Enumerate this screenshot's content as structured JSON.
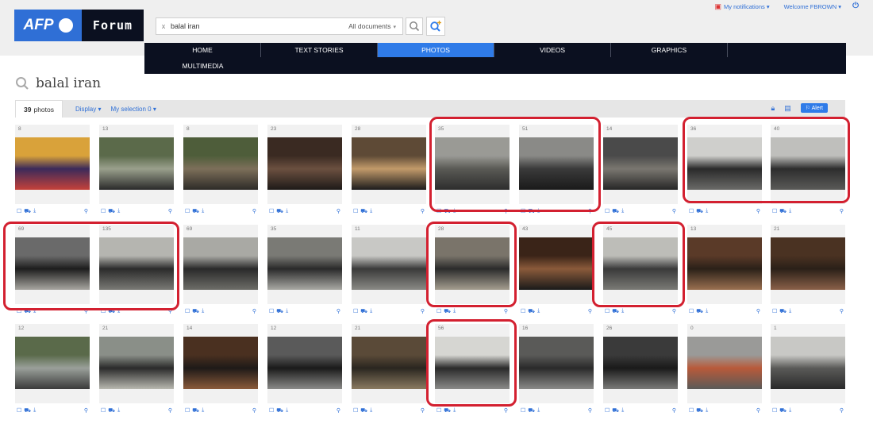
{
  "logo": {
    "afp": "AFP",
    "forum": "Forum"
  },
  "search": {
    "clear": "x",
    "query": "balal iran",
    "scope": "All documents"
  },
  "user": {
    "notifications": "My notifications",
    "welcome": "Welcome FBROWN"
  },
  "nav": {
    "items": [
      "HOME",
      "TEXT STORIES",
      "PHOTOS",
      "VIDEOS",
      "GRAPHICS",
      "MULTIMEDIA"
    ],
    "active": "PHOTOS"
  },
  "results": {
    "title": "balal iran",
    "count": "39",
    "count_label": "photos",
    "display": "Display",
    "selection": "My selection 0",
    "alert": "Alert"
  },
  "photos": [
    {
      "count": "8",
      "colors": [
        "#d9a23a",
        "#3b2a5a",
        "#c4413a"
      ]
    },
    {
      "count": "13",
      "colors": [
        "#5b6a4a",
        "#9aa08c",
        "#2a2a2a"
      ]
    },
    {
      "count": "8",
      "colors": [
        "#4e5d3a",
        "#7d6f5a",
        "#2d2b27"
      ]
    },
    {
      "count": "23",
      "colors": [
        "#3a2a22",
        "#6b5040",
        "#1e1a18"
      ]
    },
    {
      "count": "28",
      "colors": [
        "#5e4a36",
        "#c29a6a",
        "#1c1c1c"
      ]
    },
    {
      "count": "35",
      "colors": [
        "#9a9a95",
        "#5a5a55",
        "#2d2d2d"
      ]
    },
    {
      "count": "51",
      "colors": [
        "#8a8a87",
        "#3a3a3a",
        "#1a1a1a"
      ]
    },
    {
      "count": "14",
      "colors": [
        "#4a4a4a",
        "#7a7770",
        "#262626"
      ]
    },
    {
      "count": "36",
      "colors": [
        "#cfcfcc",
        "#2a2a2a",
        "#6a6a68"
      ]
    },
    {
      "count": "40",
      "colors": [
        "#bfbfbc",
        "#2d2d2d",
        "#5a5a58"
      ]
    },
    {
      "count": "69",
      "colors": [
        "#6a6a6a",
        "#1d1d1d",
        "#a8a6a0"
      ]
    },
    {
      "count": "135",
      "colors": [
        "#b5b5b0",
        "#2b2b2b",
        "#7a7a75"
      ]
    },
    {
      "count": "69",
      "colors": [
        "#a9a9a4",
        "#2a2a2a",
        "#6d6d68"
      ]
    },
    {
      "count": "35",
      "colors": [
        "#7a7a75",
        "#2a2a2a",
        "#a9a9a4"
      ]
    },
    {
      "count": "11",
      "colors": [
        "#c8c8c5",
        "#3a3a3a",
        "#8a8a85"
      ]
    },
    {
      "count": "28",
      "colors": [
        "#7a746a",
        "#2b2b2b",
        "#a59e90"
      ]
    },
    {
      "count": "43",
      "colors": [
        "#3a2418",
        "#8a5a3a",
        "#1a1a1a"
      ]
    },
    {
      "count": "45",
      "colors": [
        "#bdbdb8",
        "#3a3a3a",
        "#7a7a75"
      ]
    },
    {
      "count": "13",
      "colors": [
        "#5a3a28",
        "#2a2018",
        "#9a7050"
      ]
    },
    {
      "count": "21",
      "colors": [
        "#4a3222",
        "#2a2018",
        "#8a6048"
      ]
    },
    {
      "count": "12",
      "colors": [
        "#5a6a4a",
        "#9aa09a",
        "#3a3a3a"
      ]
    },
    {
      "count": "21",
      "colors": [
        "#8a8f88",
        "#2a2a2a",
        "#b8b8b0"
      ]
    },
    {
      "count": "14",
      "colors": [
        "#4a3020",
        "#1e1a18",
        "#8a5a3a"
      ]
    },
    {
      "count": "12",
      "colors": [
        "#5a5a5a",
        "#1a1a1a",
        "#8a8a88"
      ]
    },
    {
      "count": "21",
      "colors": [
        "#5a4a38",
        "#2a2620",
        "#8a7a60"
      ]
    },
    {
      "count": "56",
      "colors": [
        "#d6d6d2",
        "#2a2a2a",
        "#8a8a88"
      ]
    },
    {
      "count": "16",
      "colors": [
        "#5a5a58",
        "#2a2a2a",
        "#8a8a88"
      ]
    },
    {
      "count": "26",
      "colors": [
        "#3a3a3a",
        "#1a1a1a",
        "#7a7a78"
      ]
    },
    {
      "count": "0",
      "colors": [
        "#9a9a98",
        "#b85a3a",
        "#5a5a58"
      ]
    },
    {
      "count": "1",
      "colors": [
        "#c8c8c5",
        "#5a5a58",
        "#2a2a2a"
      ]
    }
  ],
  "highlight_color": "#d32030",
  "accent": "#2f7be8"
}
